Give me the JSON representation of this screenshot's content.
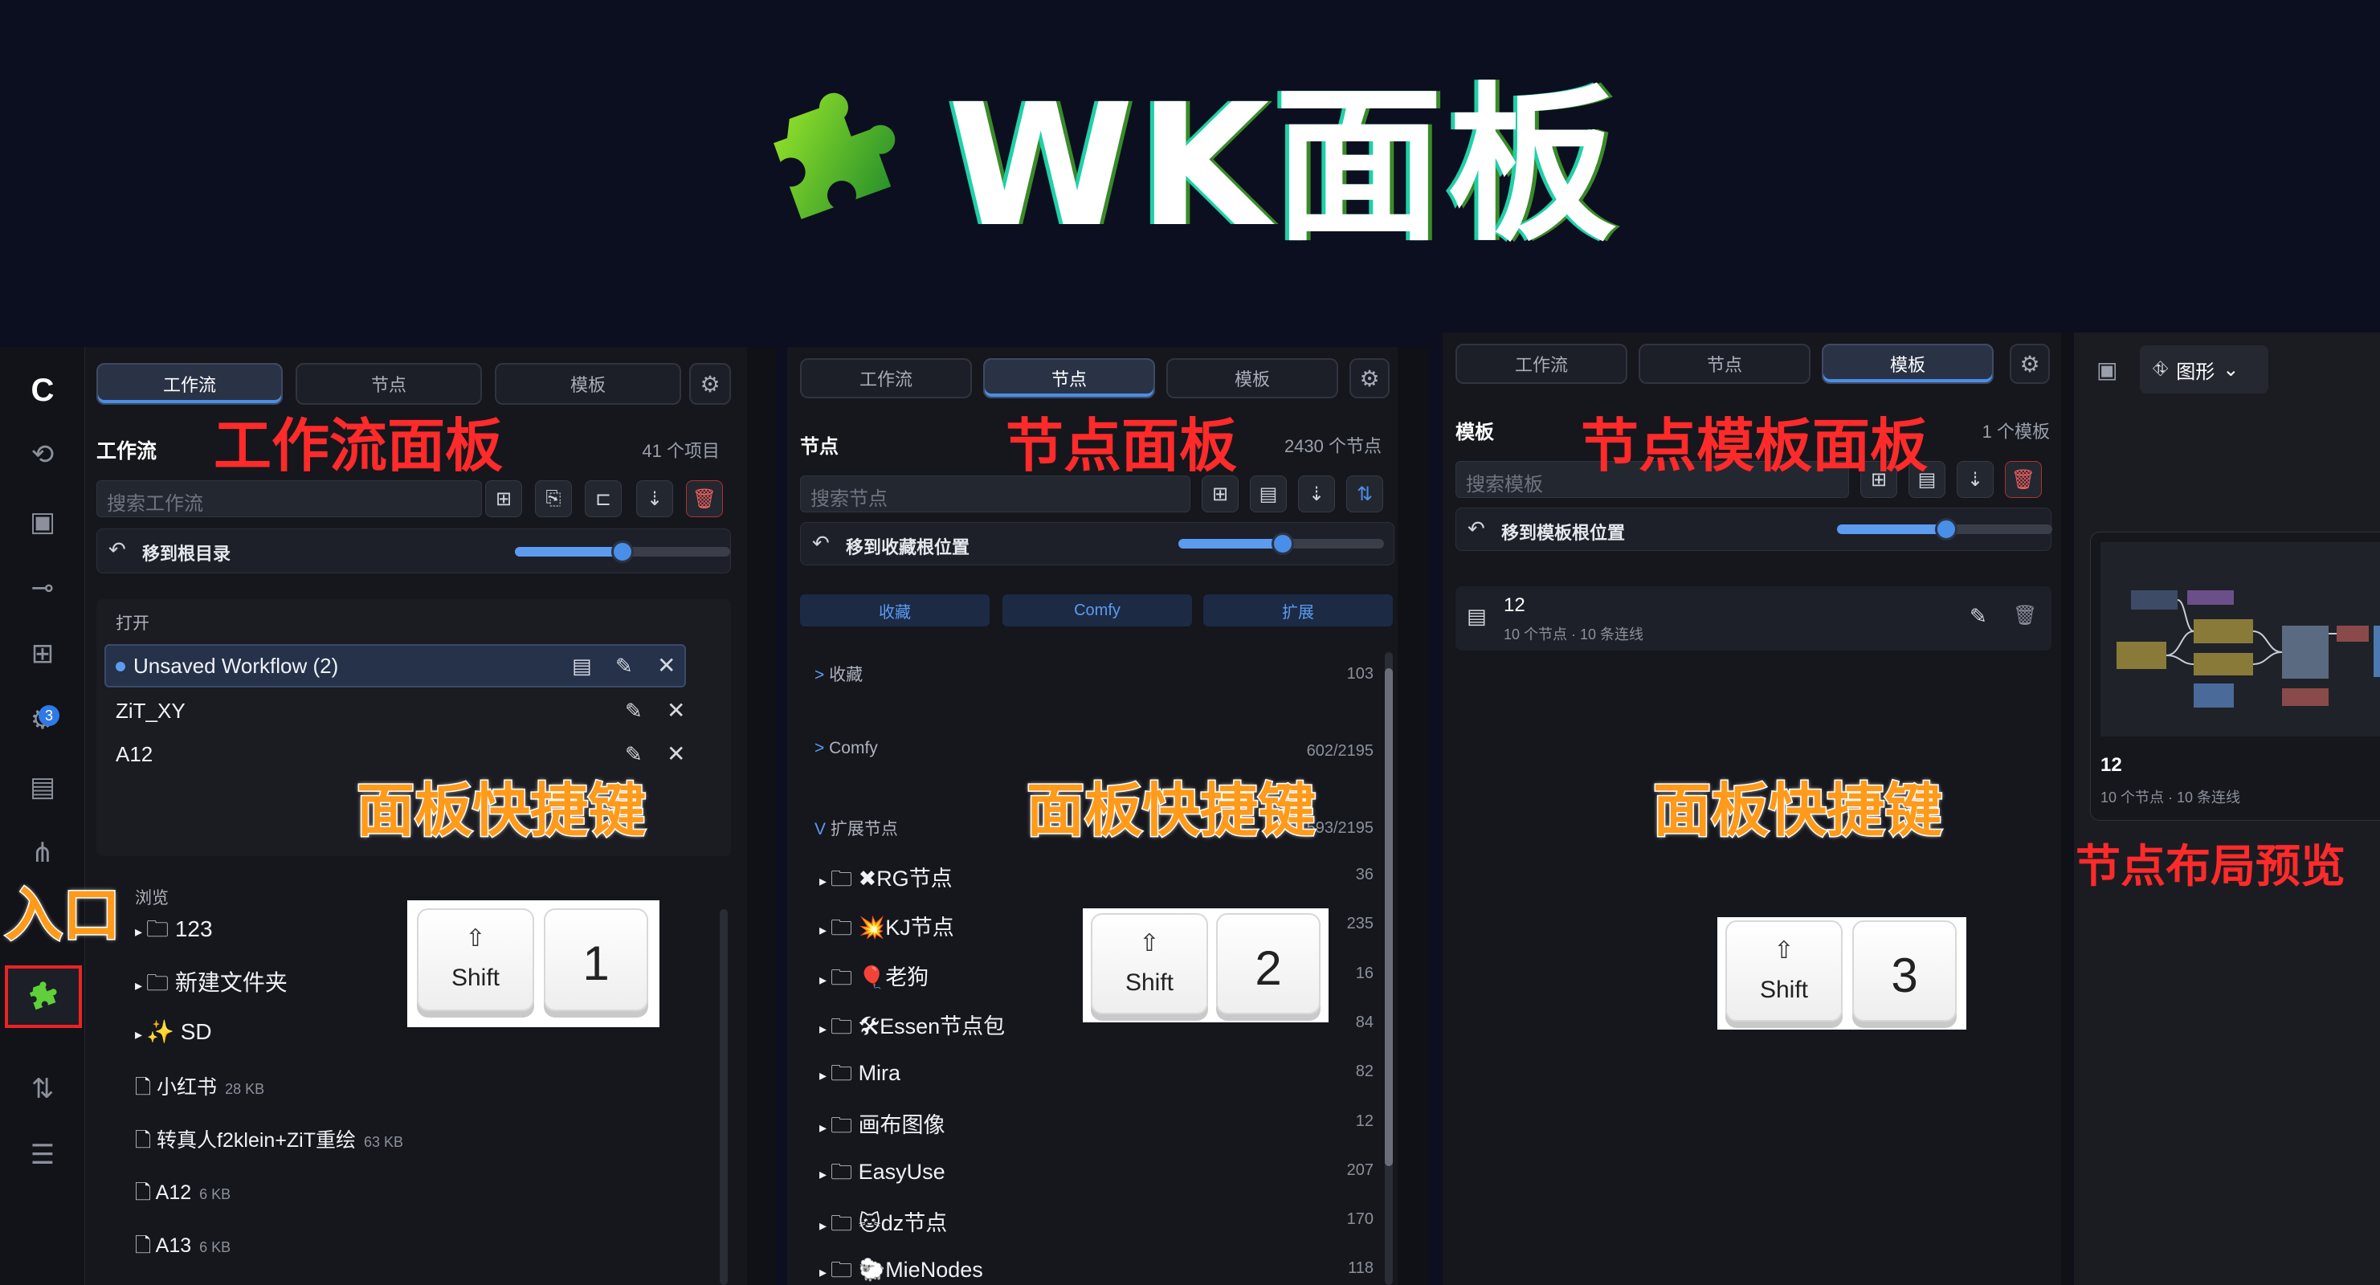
{
  "header": {
    "logo_title": "WK面板"
  },
  "labels": {
    "workflow_panel": "工作流面板",
    "node_panel": "节点面板",
    "template_panel": "节点模板面板",
    "shortcut": "面板快捷键",
    "entry": "入口",
    "layout_preview": "节点布局预览"
  },
  "tabs": [
    "工作流",
    "节点",
    "模板"
  ],
  "shortcuts": {
    "shift": "Shift",
    "keys": [
      "1",
      "2",
      "3"
    ]
  },
  "workflow_panel": {
    "title": "工作流",
    "count": "41 个项目",
    "search_placeholder": "搜索工作流",
    "root_label": "移到根目录",
    "open_section": "打开",
    "open_items": [
      "Unsaved Workflow (2)",
      "ZiT_XY",
      "A12"
    ],
    "browse_section": "浏览",
    "folders": [
      "123",
      "新建文件夹",
      "SD"
    ],
    "sd_icon": "sparkle-icon",
    "files": [
      {
        "name": "小红书",
        "size": "28 KB"
      },
      {
        "name": "转真人f2klein+ZiT重绘",
        "size": "63 KB"
      },
      {
        "name": "A12",
        "size": "6 KB"
      },
      {
        "name": "A13",
        "size": "6 KB"
      }
    ],
    "slider_value": 0.5
  },
  "sidebar": {
    "badge": "3",
    "icons": [
      "logo-icon",
      "history-icon",
      "image-icon",
      "workflow-icon",
      "extensions-icon",
      "queue-icon",
      "layout-icon",
      "tree-icon",
      "wk-panel-icon",
      "settings-sliders-icon",
      "panels-icon"
    ]
  },
  "node_panel": {
    "title": "节点",
    "count": "2430 个节点",
    "search_placeholder": "搜索节点",
    "root_label": "移到收藏根位置",
    "categories": [
      "收藏",
      "Comfy",
      "扩展"
    ],
    "groups": [
      {
        "name": "收藏",
        "count": "103"
      },
      {
        "name": "Comfy",
        "count": "602/2195"
      },
      {
        "name": "扩展节点",
        "count": "1593/2195"
      }
    ],
    "folders": [
      {
        "name": "RG节点",
        "prefix": "✖",
        "count": "36"
      },
      {
        "name": "KJ节点",
        "prefix": "💥",
        "count": "235"
      },
      {
        "name": "老狗",
        "prefix": "🎈",
        "count": "16"
      },
      {
        "name": "Essen节点包",
        "prefix": "🛠",
        "count": "84"
      },
      {
        "name": "Mira",
        "prefix": "",
        "count": "82"
      },
      {
        "name": "画布图像",
        "prefix": "",
        "count": "12"
      },
      {
        "name": "EasyUse",
        "prefix": "",
        "count": "207"
      },
      {
        "name": "dz节点",
        "prefix": "🐱",
        "count": "170"
      },
      {
        "name": "MieNodes",
        "prefix": "🐑",
        "count": "118"
      }
    ],
    "slider_value": 0.5
  },
  "template_panel": {
    "title": "模板",
    "count": "1 个模板",
    "search_placeholder": "搜索模板",
    "root_label": "移到模板根位置",
    "item": {
      "name": "12",
      "meta": "10 个节点 · 10 条连线"
    },
    "slider_value": 0.5
  },
  "preview_panel": {
    "view_label": "图形",
    "card": {
      "name": "12",
      "meta": "10 个节点 · 10 条连线"
    }
  }
}
